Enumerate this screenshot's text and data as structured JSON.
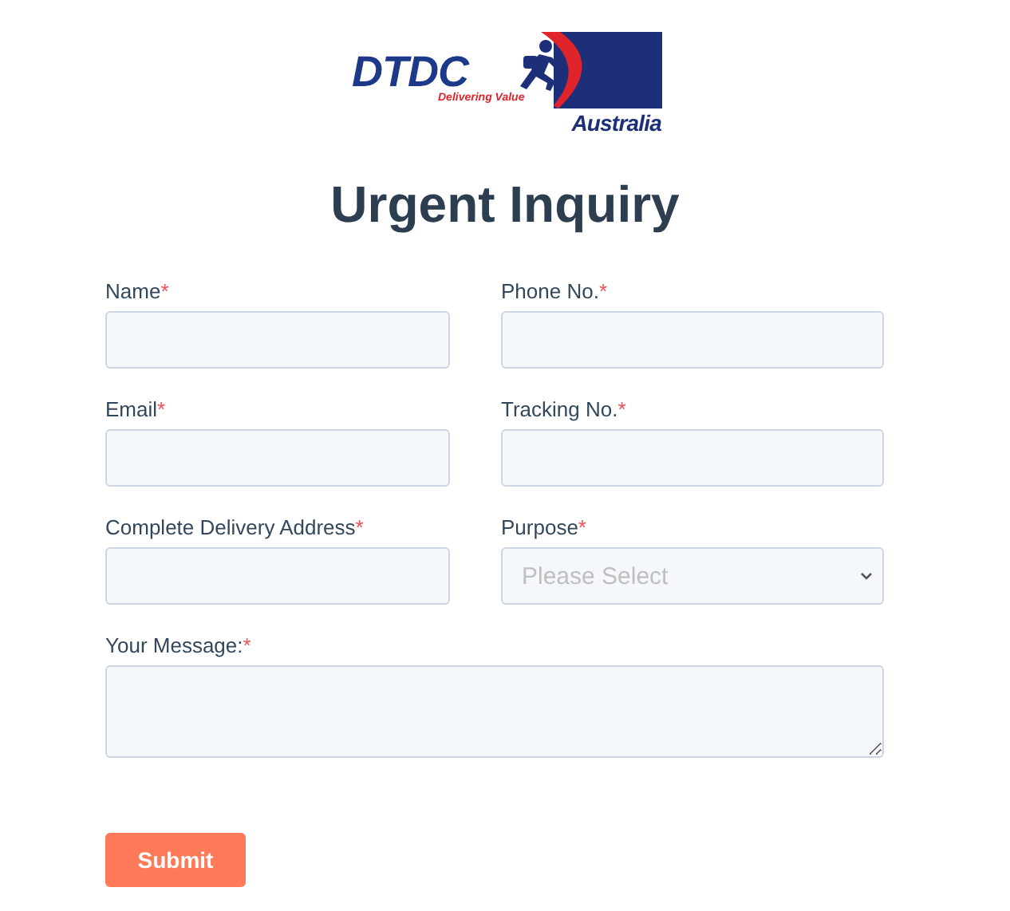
{
  "logo": {
    "wordmark": "DTDC",
    "tagline": "Delivering Value",
    "region": "Australia"
  },
  "title": "Urgent Inquiry",
  "fields": [
    {
      "label": "Name",
      "mark": "*",
      "kind": "text"
    },
    {
      "label": "Phone No.",
      "mark": "*",
      "kind": "text"
    },
    {
      "label": "Email",
      "mark": "*",
      "kind": "text"
    },
    {
      "label": "Tracking No.",
      "mark": "*",
      "kind": "text"
    },
    {
      "label": "Complete Delivery Address",
      "mark": "*",
      "kind": "text"
    },
    {
      "label": "Purpose",
      "mark": "*",
      "kind": "select",
      "placeholder": "Please Select"
    },
    {
      "label": "Your Message:",
      "mark": "*",
      "kind": "textarea"
    }
  ],
  "submit": "Submit"
}
